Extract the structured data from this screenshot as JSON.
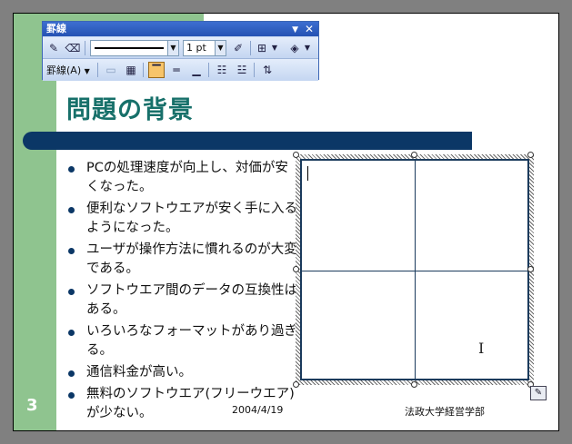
{
  "toolbar": {
    "title": "罫線",
    "menu_arrow": "▼",
    "close": "✕",
    "line_width": "1 pt",
    "borders_label": "罫線(A)",
    "dropdown_arrow": "▼",
    "icons": {
      "draw_table": "pencil-table-icon",
      "eraser": "eraser-icon",
      "pen_color": "pen-color-icon",
      "outside_border": "outside-border-icon",
      "fill_color": "fill-color-icon",
      "merge_cells": "merge-cells-icon",
      "split_cells": "split-cells-icon",
      "align_top": "align-top-icon",
      "align_center": "align-center-icon",
      "align_bottom": "align-bottom-icon",
      "distribute_rows": "distribute-rows-icon",
      "distribute_columns": "distribute-columns-icon",
      "text_direction": "text-direction-icon"
    }
  },
  "slide": {
    "number": "3",
    "title": "問題の背景",
    "bullets": [
      "PCの処理速度が向上し、対価が安くなった。",
      "便利なソフトウエアが安く手に入るようになった。",
      "ユーザが操作方法に慣れるのが大変である。",
      "ソフトウエア間のデータの互換性はある。",
      "いろいろなフォーマットがあり過ぎる。",
      "通信料金が高い。",
      "無料のソフトウエア(フリーウエア)が少ない。"
    ],
    "footer_date": "2004/4/19",
    "footer_org": "法政大学経営学部"
  },
  "colors": {
    "accent_green": "#8fc48f",
    "title_teal": "#17706a",
    "navy": "#0b3766"
  }
}
